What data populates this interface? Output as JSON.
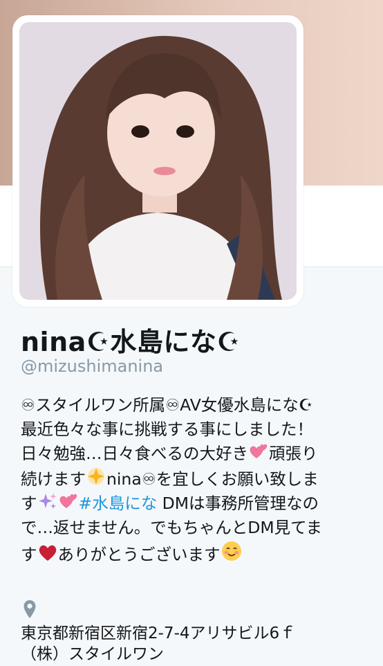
{
  "profile": {
    "display_name": "nina☪水島にな☪",
    "screen_name": "@mizushimanina",
    "bio": {
      "line1": "♾スタイルワン所属♾AV女優水島にな☪",
      "line2": "最近色々な事に挑戦する事にしました！",
      "line3a": "日々勉強…日々食べるの大好き",
      "line3b": "頑張り",
      "line4a": "続けます",
      "line4b": "nina♾を宜しくお願い致しま",
      "line5a": "す",
      "line5_hashtag": "#水島にな",
      "line5b": " DMは事務所管理なの",
      "line6": "で…返せません。でもちゃんとDM見てま",
      "line7a": "す",
      "line7b": "ありがとうございます"
    },
    "location": {
      "line1": "東京都新宿区新宿2-7-4アリサビル6ｆ",
      "line2": "（株）スタイルワン"
    }
  },
  "colors": {
    "accent": "#1b95e0",
    "secondary_text": "#8899a6",
    "page_bg": "#f5f8fa"
  },
  "icons": [
    "location-pin-icon",
    "two-hearts-emoji",
    "glowing-star-emoji",
    "sparkles-emoji",
    "red-heart-emoji",
    "smiling-face-emoji"
  ]
}
